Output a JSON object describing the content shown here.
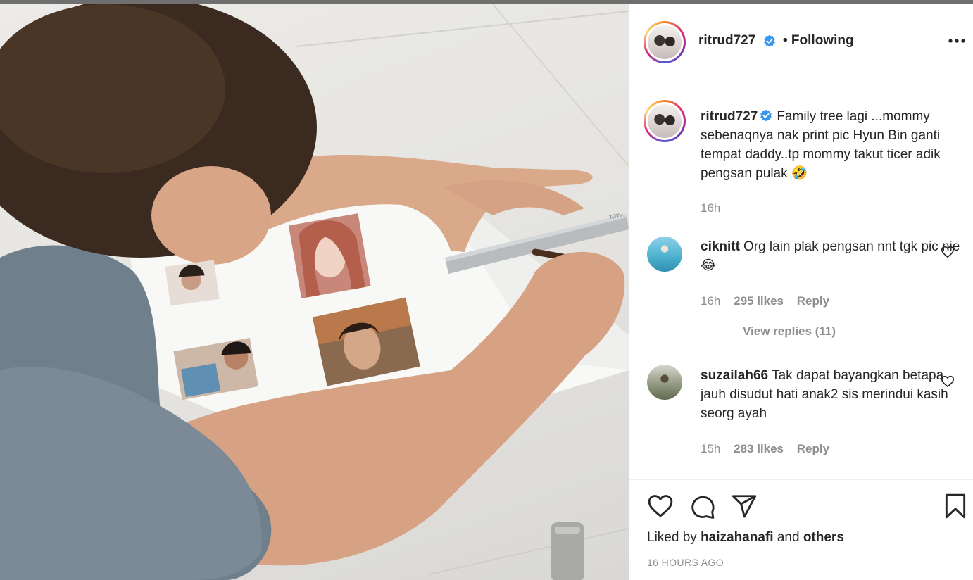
{
  "post": {
    "author": "ritrud727",
    "follow_status": "• Following",
    "caption": "Family tree lagi ...mommy sebenaqnya nak print pic Hyun Bin ganti tempat daddy..tp mommy takut ticer adik pengsan pulak 🤣",
    "caption_time": "16h",
    "liked_by_prefix": "Liked by",
    "liked_by_user": "haizahanafi",
    "liked_by_and": "and",
    "liked_by_others": "others",
    "time_ago": "16 HOURS AGO"
  },
  "comments": [
    {
      "username": "ciknitt",
      "text": "Org lain plak pengsan nnt tgk pic nie 😂",
      "time": "16h",
      "likes": "295 likes",
      "reply": "Reply",
      "view_replies": "View replies (11)"
    },
    {
      "username": "suzailah66",
      "text": "Tak dapat bayangkan betapa jauh disudut hati anak2 sis merindui kasih seorg ayah",
      "time": "15h",
      "likes": "283 likes",
      "reply": "Reply"
    }
  ],
  "photo": {
    "ruler_brand": "TOYO"
  },
  "colors": {
    "verified": "#3897f0",
    "muted": "#8e8e8e",
    "text": "#262626"
  },
  "icons": {
    "like": "heart-icon",
    "comment": "comment-icon",
    "share": "paper-plane-icon",
    "save": "bookmark-icon",
    "more": "more-dots-icon",
    "verified": "verified-badge-icon"
  }
}
